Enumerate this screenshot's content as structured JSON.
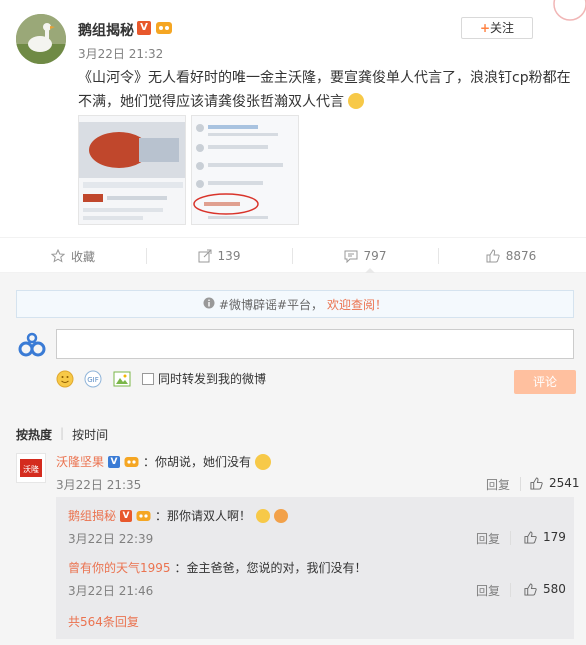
{
  "post": {
    "author": "鹅组揭秘",
    "time": "3月22日 21:32",
    "follow_label": "关注",
    "text": "《山河令》无人看好时的唯一金主沃隆，要宣龚俊单人代言了，浪浪钉cp粉都在不满，她们觉得应该请龚俊张哲瀚双人代言",
    "badge": "V"
  },
  "actions": {
    "favorite": "收藏",
    "forward": "139",
    "comment": "797",
    "like": "8876"
  },
  "notice": {
    "prefix": "#微博辟谣#平台，",
    "link": "欢迎查阅！"
  },
  "composer": {
    "forward_label": "同时转发到我的微博",
    "submit_label": "评论"
  },
  "sort": {
    "hot": "按热度",
    "time": "按时间"
  },
  "comment": {
    "author": "沃隆坚果",
    "avatar_text": "沃隆",
    "text": "：你胡说，她们没有",
    "time": "3月22日 21:35",
    "reply_label": "回复",
    "likes": "2541"
  },
  "replies": [
    {
      "author": "鹅组揭秘",
      "text": "：那你请双人啊！",
      "time": "3月22日 22:39",
      "reply_label": "回复",
      "likes": "179"
    },
    {
      "author": "曾有你的天气1995",
      "text": "：金主爸爸，您说的对，我们没有！",
      "time": "3月22日 21:46",
      "reply_label": "回复",
      "likes": "580"
    }
  ],
  "more_replies": "共564条回复",
  "colors": {
    "accent": "#eb7350",
    "submit": "#ffc09f",
    "background": "#f5f5f5"
  }
}
